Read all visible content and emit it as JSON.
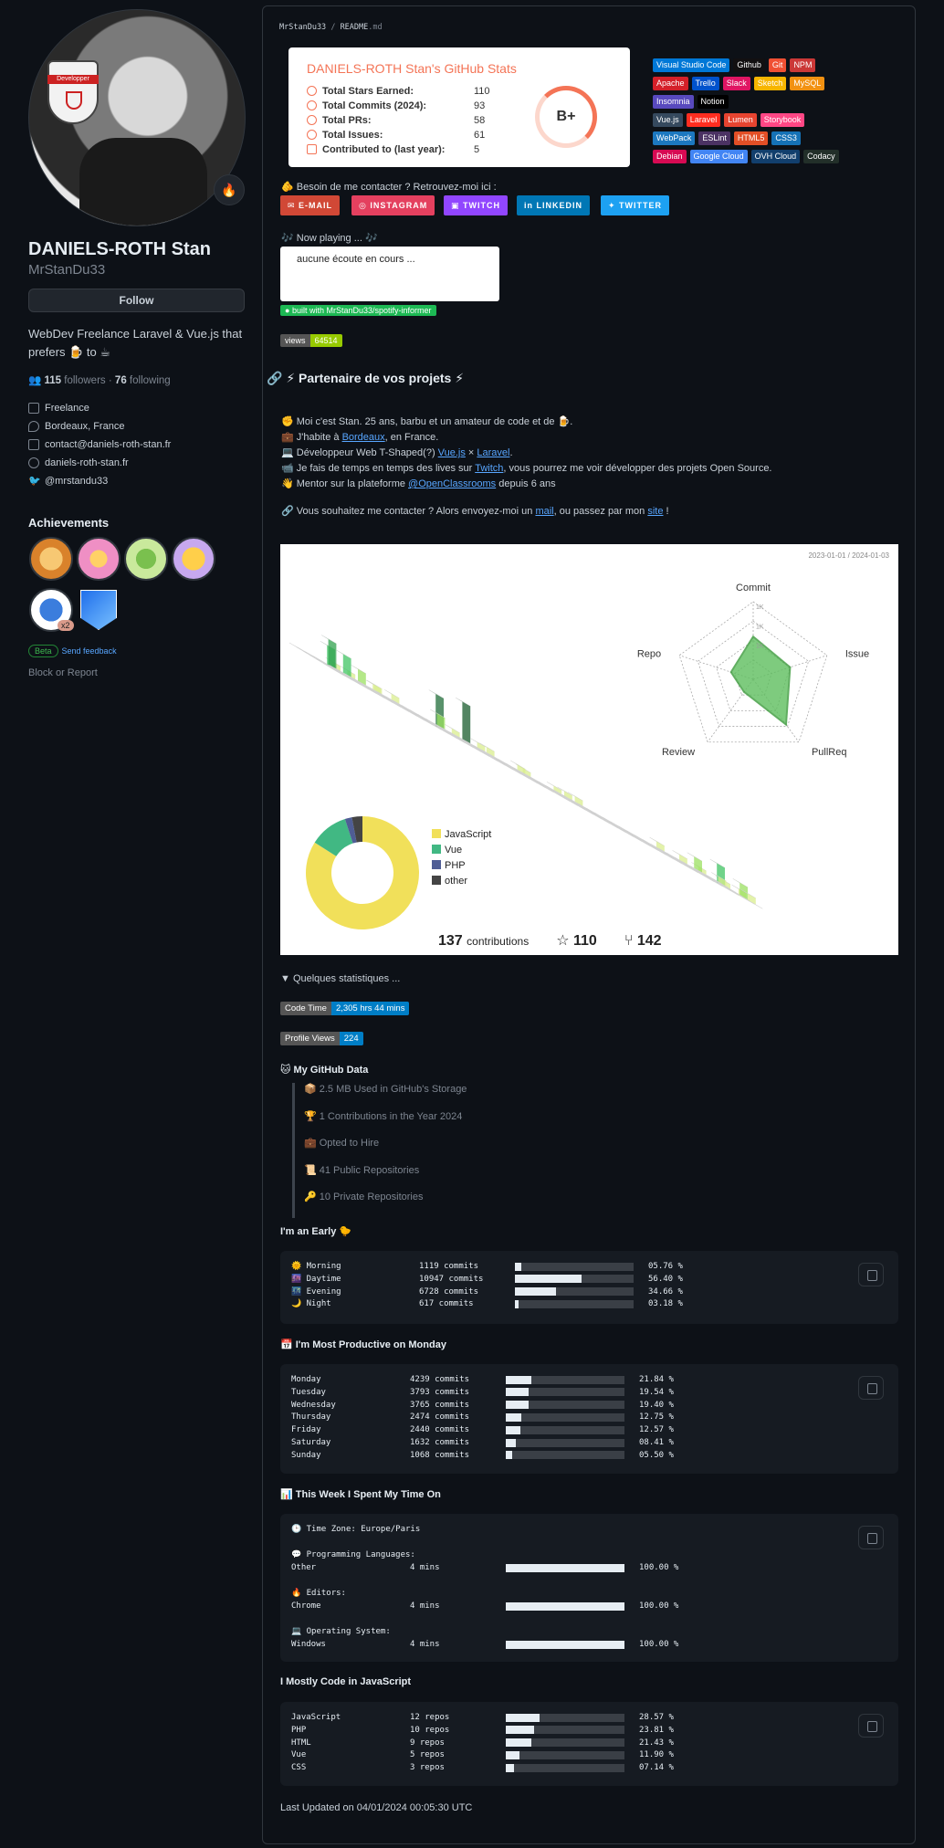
{
  "profile": {
    "name": "DANIELS-ROTH Stan",
    "login": "MrStanDu33",
    "follow_label": "Follow",
    "avatar_badge": "Developper",
    "bio_1": "WebDev Freelance Laravel & Vue.js that",
    "bio_2": "prefers 🍺 to ☕",
    "followers_count": "115",
    "followers_label": "followers",
    "following_count": "76",
    "following_label": "following",
    "separator": "·",
    "company": "Freelance",
    "location": "Bordeaux, France",
    "email": "contact@daniels-roth-stan.fr",
    "website": "daniels-roth-stan.fr",
    "twitter": "@mrstandu33",
    "achievements_title": "Achievements",
    "achievement_count": "x2",
    "beta_label": "Beta",
    "feedback_label": "Send feedback",
    "block_label": "Block or Report",
    "status_emoji": "🔥"
  },
  "readme": {
    "crumb_user": "MrStanDu33",
    "crumb_sep": "/",
    "crumb_file": "README",
    "crumb_ext": ".md"
  },
  "stats_card": {
    "title": "DANIELS-ROTH Stan's GitHub Stats",
    "rows": [
      {
        "label": "Total Stars Earned:",
        "value": "110"
      },
      {
        "label": "Total Commits (2024):",
        "value": "93"
      },
      {
        "label": "Total PRs:",
        "value": "58"
      },
      {
        "label": "Total Issues:",
        "value": "61"
      },
      {
        "label": "Contributed to (last year):",
        "value": "5"
      }
    ],
    "grade": "B+",
    "accent": "#f47456"
  },
  "tags": [
    {
      "label": "Visual Studio Code",
      "color": "#0078d7"
    },
    {
      "label": "Github",
      "color": "#121011"
    },
    {
      "label": "Git",
      "color": "#f05033"
    },
    {
      "label": "NPM",
      "color": "#cb3837"
    },
    {
      "label": "Apache",
      "color": "#d42029"
    },
    {
      "label": "Trello",
      "color": "#0052cc"
    },
    {
      "label": "Slack",
      "color": "#e01563"
    },
    {
      "label": "Sketch",
      "color": "#f7b500"
    },
    {
      "label": "MySQL",
      "color": "#f29111"
    },
    {
      "label": "Insomnia",
      "color": "#5849be"
    },
    {
      "label": "Notion",
      "color": "#000000"
    },
    {
      "label": "Vue.js",
      "color": "#35495e"
    },
    {
      "label": "Laravel",
      "color": "#ff2d20"
    },
    {
      "label": "Lumen",
      "color": "#e74430"
    },
    {
      "label": "Storybook",
      "color": "#ff4785"
    },
    {
      "label": "WebPack",
      "color": "#8dd6f9"
    },
    {
      "label": "ESLint",
      "color": "#4b3263"
    },
    {
      "label": "HTML5",
      "color": "#e34f26"
    },
    {
      "label": "CSS3",
      "color": "#1572b6"
    },
    {
      "label": "Debian",
      "color": "#d70a53"
    },
    {
      "label": "Google Cloud",
      "color": "#4285f4"
    },
    {
      "label": "OVH Cloud",
      "color": "#123f6d"
    },
    {
      "label": "Codacy",
      "color": "#222f29"
    }
  ],
  "contact": {
    "line": "🫵 Besoin de me contacter ? Retrouvez-moi ici :",
    "links": [
      {
        "label": "E-MAIL",
        "color": "#d14836"
      },
      {
        "label": "INSTAGRAM",
        "color": "#e4405f"
      },
      {
        "label": "TWITCH",
        "color": "#9146ff"
      },
      {
        "label": "LINKEDIN",
        "color": "#0077b5"
      },
      {
        "label": "TWITTER",
        "color": "#1da1f2"
      }
    ]
  },
  "spotify": {
    "now_playing": "🎶 Now playing ... 🎶",
    "status": "aucune écoute en cours ...",
    "tag": "built with MrStanDu33/spotify-informer"
  },
  "views_badge": {
    "label": "views",
    "value": "64514"
  },
  "partner_heading": "🔗 ⚡ Partenaire de vos projets ⚡",
  "intro": {
    "l1": "✊ Moi c'est Stan. 25 ans, barbu et un amateur de code et de 🍺.",
    "l2a": "💼 J'habite à ",
    "l2b": "Bordeaux",
    "l2c": ", en France.",
    "l3a": "💻 Développeur Web T-Shaped(?) ",
    "l3b": "Vue.js",
    "l3c": " × ",
    "l3d": "Laravel",
    "l3e": ".",
    "l4a": "📹 Je fais de temps en temps des lives sur ",
    "l4b": "Twitch",
    "l4c": ", vous pourrez me voir développer des projets Open Source.",
    "l5a": "👋 Mentor sur la plateforme ",
    "l5b": "@OpenClassrooms",
    "l5c": " depuis 6 ans",
    "l6a": "🔗 Vous souhaitez me contacter ? Alors envoyez-moi un ",
    "l6b": "mail",
    "l6c": ", ou passez par mon ",
    "l6d": "site",
    "l6e": " !"
  },
  "chart_data": [
    {
      "type": "radar",
      "categories": [
        "Commit",
        "Issue",
        "PullReq",
        "Review",
        "Repo"
      ],
      "tick_labels": [
        "1K",
        "1K",
        "1K"
      ],
      "values_relative": [
        0.55,
        0.5,
        0.72,
        0.2,
        0.3
      ],
      "date_range": "2023-01-01 / 2024-01-03"
    },
    {
      "type": "pie",
      "categories": [
        "JavaScript",
        "Vue",
        "PHP",
        "other"
      ],
      "values": [
        84,
        11,
        2,
        3
      ],
      "colors": [
        "#f1e05a",
        "#41b883",
        "#4f5d95",
        "#444444"
      ]
    }
  ],
  "contrib_totals": {
    "contributions": "137",
    "contributions_label": "contributions",
    "stars": "110",
    "forks": "142"
  },
  "quick_stats": "▼ Quelques statistiques ...",
  "code_time": {
    "label": "Code Time",
    "value": "2,305 hrs 44 mins"
  },
  "profile_views": {
    "label": "Profile Views",
    "value": "224"
  },
  "gh_data": {
    "title": "🐱 My GitHub Data",
    "items": [
      "📦 2.5 MB Used in GitHub's Storage",
      "🏆 1 Contributions in the Year 2024",
      "💼 Opted to Hire",
      "📜 41 Public Repositories",
      "🔑 10 Private Repositories"
    ]
  },
  "early": {
    "title": "I'm an Early 🐤",
    "rows": [
      {
        "name": "🌞 Morning",
        "commits": "1119 commits",
        "pct": "05.76 %",
        "frac": 0.0576
      },
      {
        "name": "🌆 Daytime",
        "commits": "10947 commits",
        "pct": "56.40 %",
        "frac": 0.564
      },
      {
        "name": "🌃 Evening",
        "commits": "6728 commits",
        "pct": "34.66 %",
        "frac": 0.3466
      },
      {
        "name": "🌙 Night",
        "commits": "617 commits",
        "pct": "03.18 %",
        "frac": 0.0318
      }
    ]
  },
  "weekday": {
    "title": "📅 I'm Most Productive on Monday",
    "rows": [
      {
        "name": "Monday",
        "commits": "4239 commits",
        "pct": "21.84 %",
        "frac": 0.2184
      },
      {
        "name": "Tuesday",
        "commits": "3793 commits",
        "pct": "19.54 %",
        "frac": 0.1954
      },
      {
        "name": "Wednesday",
        "commits": "3765 commits",
        "pct": "19.40 %",
        "frac": 0.194
      },
      {
        "name": "Thursday",
        "commits": "2474 commits",
        "pct": "12.75 %",
        "frac": 0.1275
      },
      {
        "name": "Friday",
        "commits": "2440 commits",
        "pct": "12.57 %",
        "frac": 0.1257
      },
      {
        "name": "Saturday",
        "commits": "1632 commits",
        "pct": "08.41 %",
        "frac": 0.0841
      },
      {
        "name": "Sunday",
        "commits": "1068 commits",
        "pct": "05.50 %",
        "frac": 0.055
      }
    ]
  },
  "week": {
    "title": "📊 This Week I Spent My Time On",
    "timezone": "🕒 Time Zone: Europe/Paris",
    "lang_label": "💬 Programming Languages:",
    "lang_row": {
      "name": "Other",
      "time": "4 mins",
      "pct": "100.00 %",
      "frac": 1
    },
    "editor_label": "🔥 Editors:",
    "editor_row": {
      "name": "Chrome",
      "time": "4 mins",
      "pct": "100.00 %",
      "frac": 1
    },
    "os_label": "💻 Operating System:",
    "os_row": {
      "name": "Windows",
      "time": "4 mins",
      "pct": "100.00 %",
      "frac": 1
    }
  },
  "langs": {
    "title": "I Mostly Code in JavaScript",
    "rows": [
      {
        "name": "JavaScript",
        "repos": "12 repos",
        "pct": "28.57 %",
        "frac": 0.2857
      },
      {
        "name": "PHP",
        "repos": "10 repos",
        "pct": "23.81 %",
        "frac": 0.2381
      },
      {
        "name": "HTML",
        "repos": "9 repos",
        "pct": "21.43 %",
        "frac": 0.2143
      },
      {
        "name": "Vue",
        "repos": "5 repos",
        "pct": "11.90 %",
        "frac": 0.119
      },
      {
        "name": "CSS",
        "repos": "3 repos",
        "pct": "07.14 %",
        "frac": 0.0714
      }
    ]
  },
  "updated": "Last Updated on 04/01/2024 00:05:30 UTC"
}
